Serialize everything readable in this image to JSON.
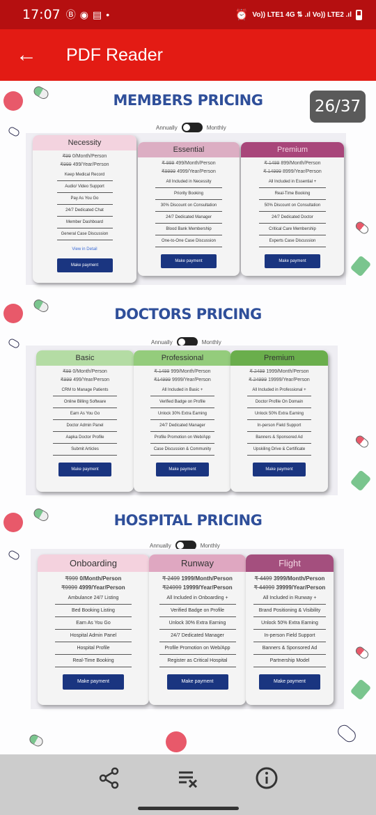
{
  "status": {
    "time": "17:07",
    "icons_left": [
      "Ⓑ",
      "◉",
      "▤",
      "•"
    ],
    "network": "Vo)) LTE1 4G ⇅ .ıl Vo)) LTE2 .ıl",
    "alarm": "⏰"
  },
  "appbar": {
    "title": "PDF Reader",
    "back_icon": "←"
  },
  "page_counter": "26/37",
  "members": {
    "title": "MEMBERS PRICING",
    "toggle_left": "Annually",
    "toggle_right": "Monthly",
    "cards": [
      {
        "name": "Necessity",
        "price_month_old": "₹99",
        "price_month": "0/Month/Person",
        "price_year_old": "₹999",
        "price_year": "499/Year/Person",
        "features": [
          "Keep Medical Record",
          "Audio/ Video Support",
          "Pay As You Go",
          "24/7 Dedicated Chat",
          "Member Dashboard",
          "General Case Discussion"
        ],
        "link": "View in Detail",
        "button": "Make payment"
      },
      {
        "name": "Essential",
        "price_month_old": "₹ 999",
        "price_month": "499/Month/Person",
        "price_year_old": "₹9999",
        "price_year": "4999/Year/Person",
        "features": [
          "All Included in Necessity",
          "Priority Booking",
          "30% Discount on Consultation",
          "24/7 Dedicated Manager",
          "Blood Bank Membership",
          "One-to-One Case Discussion"
        ],
        "button": "Make payment"
      },
      {
        "name": "Premium",
        "price_month_old": "₹ 1499",
        "price_month": "899/Month/Person",
        "price_year_old": "₹ 14999",
        "price_year": "8999/Year/Person",
        "features": [
          "All Included in Essential +",
          "Real-Time Booking",
          "50% Discount on Consultation",
          "24/7 Dedicated Doctor",
          "Critical Care Membership",
          "Experts Case Discussion"
        ],
        "button": "Make payment"
      }
    ]
  },
  "doctors": {
    "title": "DOCTORS PRICING",
    "toggle_left": "Annually",
    "toggle_right": "Monthly",
    "cards": [
      {
        "name": "Basic",
        "price_month_old": "₹99",
        "price_month": "0/Month/Person",
        "price_year_old": "₹999",
        "price_year": "499/Year/Person",
        "features": [
          "CRM to Manage Patients",
          "Online Billing Software",
          "Earn As You Go",
          "Doctor Admin Panel",
          "Aapka Doctor Profile",
          "Submit Articles"
        ],
        "button": "Make payment"
      },
      {
        "name": "Professional",
        "price_month_old": "₹ 1499",
        "price_month": "999/Month/Person",
        "price_year_old": "₹14999",
        "price_year": "9999/Year/Person",
        "features": [
          "All Included in Basic +",
          "Verified Badge on Profile",
          "Unlock 30% Extra Earning",
          "24/7 Dedicated Manager",
          "Profile Promotion on Web/App",
          "Case Discussion & Community"
        ],
        "button": "Make payment"
      },
      {
        "name": "Premium",
        "price_month_old": "₹ 2499",
        "price_month": "1999/Month/Person",
        "price_year_old": "₹ 24999",
        "price_year": "19999/Year/Person",
        "features": [
          "All Included in Professional +",
          "Doctor Profile On Domain",
          "Unlock 50% Extra Earning",
          "In-person Field Support",
          "Banners & Sponsored Ad",
          "Upskiling Drive & Certificate"
        ],
        "button": "Make payment"
      }
    ]
  },
  "hospital": {
    "title": "HOSPITAL PRICING",
    "toggle_left": "Annually",
    "toggle_right": "Monthly",
    "cards": [
      {
        "name": "Onboarding",
        "price_month_old": "₹999",
        "price_month": "0/Month/Person",
        "price_year_old": "₹9999",
        "price_year": "4999/Year/Person",
        "features": [
          "Ambulance 24/7 Listing",
          "Bed Booking Listing",
          "Earn As You Go",
          "Hospital Admin Panel",
          "Hospital Profile",
          "Real-Time Booking"
        ],
        "button": "Make payment"
      },
      {
        "name": "Runway",
        "price_month_old": "₹ 2499",
        "price_month": "1999/Month/Person",
        "price_year_old": "₹24999",
        "price_year": "19999/Year/Person",
        "features": [
          "All Included in Onboarding +",
          "Verified Badge on Profile",
          "Unlock 30% Extra Earning",
          "24/7 Dedicated Manager",
          "Profile Promotion on Web/App",
          "Register as Critical Hospital"
        ],
        "button": "Make payment"
      },
      {
        "name": "Flight",
        "price_month_old": "₹ 4499",
        "price_month": "3999/Month/Person",
        "price_year_old": "₹ 44999",
        "price_year": "39999/Year/Person",
        "features": [
          "All Included in Runway +",
          "Brand Positioning & Visibility",
          "Unlock 50% Extra Earning",
          "In-person Field Support",
          "Banners & Sponsored Ad",
          "Partnership Model"
        ],
        "button": "Make payment"
      }
    ]
  },
  "colors": {
    "members_hd": [
      "#f3d3df",
      "#dcaec3",
      "#a8467a"
    ],
    "doctors_hd": [
      "#b4dca4",
      "#94cc7c",
      "#6aae4c"
    ],
    "hospital_hd": [
      "#f4d2de",
      "#dfa7c1",
      "#a44f7e"
    ]
  },
  "bottom": {
    "share_icon": "share-icon",
    "clear_icon": "clear-list-icon",
    "info_icon": "info-icon"
  }
}
